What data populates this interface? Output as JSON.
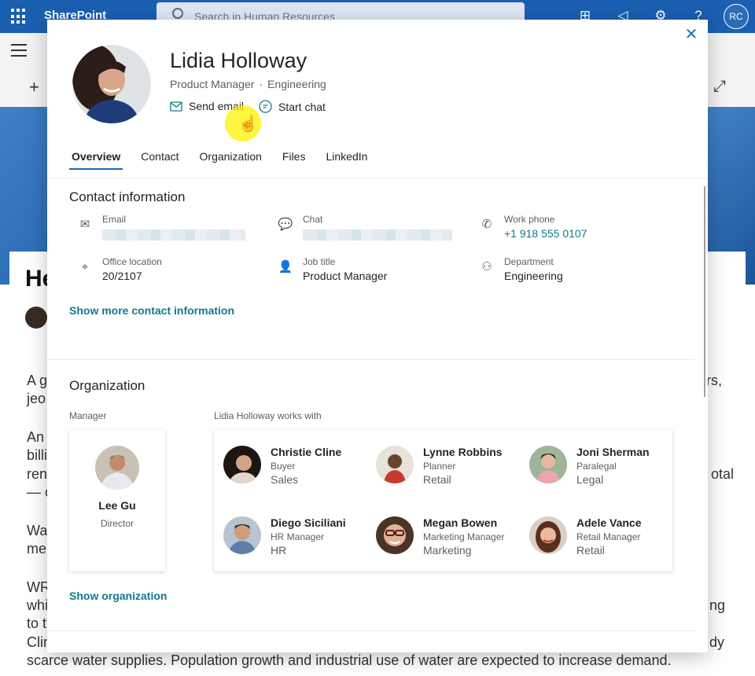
{
  "suite": {
    "brand": "SharePoint",
    "search_placeholder": "Search in Human Resources",
    "me_initials": "RC"
  },
  "article": {
    "title_fragment": "He",
    "lines": [
      {
        "left": "A g",
        "right": "rs,"
      },
      {
        "left": "jeo",
        "right": ""
      },
      {
        "left": "An",
        "right": ""
      },
      {
        "left": "billi",
        "right": ""
      },
      {
        "left": "ren",
        "right": "otal"
      },
      {
        "left": "— c",
        "right": ""
      },
      {
        "left": "Wa",
        "right": ""
      },
      {
        "left": "me",
        "right": ""
      },
      {
        "left": "WR",
        "right": ""
      },
      {
        "left": "whi",
        "right": "ng"
      },
      {
        "left": "to t",
        "right": ""
      },
      {
        "left": "Clin",
        "right": "dy"
      }
    ],
    "last_line": "scarce water supplies. Population growth and industrial use of water are expected to increase demand."
  },
  "profile": {
    "name": "Lidia Holloway",
    "title": "Product Manager",
    "department": "Engineering",
    "actions": {
      "email": "Send email",
      "chat": "Start chat"
    },
    "tabs": [
      "Overview",
      "Contact",
      "Organization",
      "Files",
      "LinkedIn"
    ],
    "active_tab": "Overview"
  },
  "contact": {
    "heading": "Contact information",
    "email_label": "Email",
    "chat_label": "Chat",
    "phone_label": "Work phone",
    "phone": "+1 918 555 0107",
    "office_label": "Office location",
    "office": "20/2107",
    "jobtitle_label": "Job title",
    "jobtitle": "Product Manager",
    "dept_label": "Department",
    "dept": "Engineering",
    "more_link": "Show more contact information"
  },
  "organization": {
    "heading": "Organization",
    "manager_label": "Manager",
    "manager": {
      "name": "Lee Gu",
      "title": "Director"
    },
    "works_with_label": "Lidia Holloway works with",
    "peers": [
      {
        "name": "Christie Cline",
        "title": "Buyer",
        "dept": "Sales"
      },
      {
        "name": "Lynne Robbins",
        "title": "Planner",
        "dept": "Retail"
      },
      {
        "name": "Joni Sherman",
        "title": "Paralegal",
        "dept": "Legal"
      },
      {
        "name": "Diego Siciliani",
        "title": "HR Manager",
        "dept": "HR"
      },
      {
        "name": "Megan Bowen",
        "title": "Marketing Manager",
        "dept": "Marketing"
      },
      {
        "name": "Adele Vance",
        "title": "Retail Manager",
        "dept": "Retail"
      }
    ],
    "show_link": "Show organization"
  },
  "colors": {
    "accent": "#0f6cbd",
    "link": "#0f7a8c",
    "suitebar": "#1b5fb0"
  }
}
